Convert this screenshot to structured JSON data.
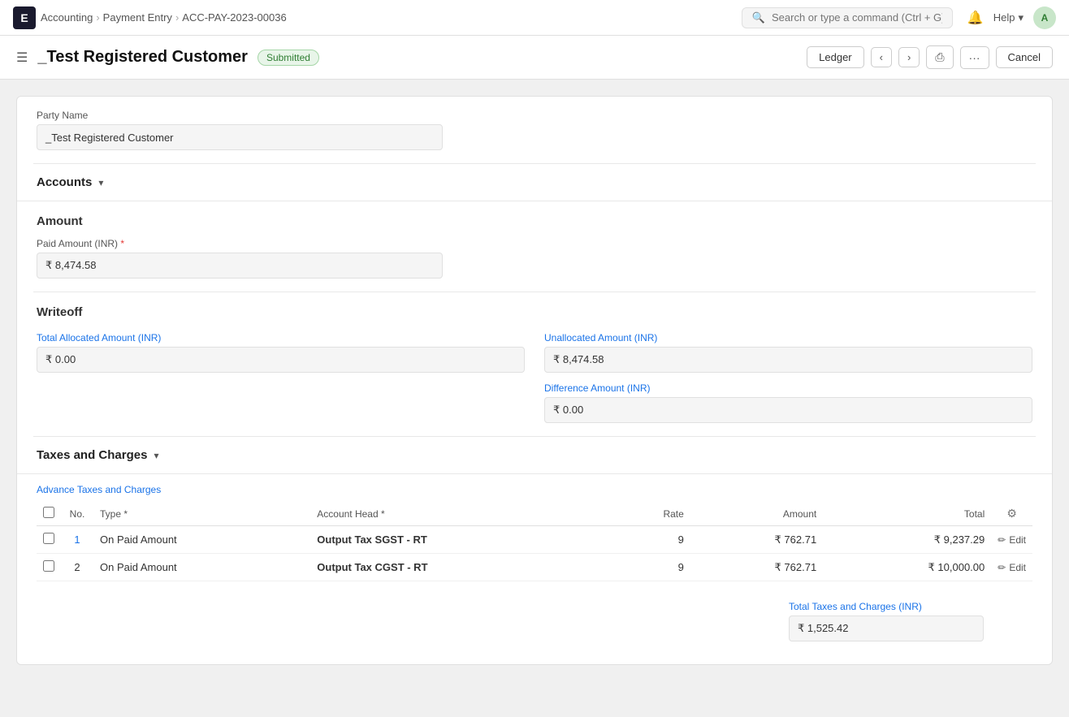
{
  "topbar": {
    "logo_letter": "E",
    "breadcrumb": [
      {
        "label": "Accounting",
        "href": "#"
      },
      {
        "label": "Payment Entry",
        "href": "#"
      },
      {
        "label": "ACC-PAY-2023-00036",
        "href": "#"
      }
    ],
    "search_placeholder": "Search or type a command (Ctrl + G)",
    "help_label": "Help",
    "avatar_letter": "A"
  },
  "page": {
    "hamburger_icon": "☰",
    "title": "_Test Registered Customer",
    "status": "Submitted",
    "actions": {
      "ledger": "Ledger",
      "prev": "‹",
      "next": "›",
      "print": "⎙",
      "more": "···",
      "cancel": "Cancel"
    }
  },
  "party_name": {
    "label": "Party Name",
    "value": "_Test Registered Customer"
  },
  "accounts_section": {
    "title": "Accounts",
    "chevron": "▾"
  },
  "amount_section": {
    "title": "Amount",
    "paid_amount_label": "Paid Amount (INR)",
    "paid_amount_required": "*",
    "paid_amount_value": "₹ 8,474.58"
  },
  "writeoff_section": {
    "title": "Writeoff",
    "total_allocated_label": "Total Allocated Amount (INR)",
    "total_allocated_value": "₹ 0.00",
    "unallocated_label": "Unallocated Amount (INR)",
    "unallocated_value": "₹ 8,474.58",
    "difference_label": "Difference Amount (INR)",
    "difference_value": "₹ 0.00"
  },
  "taxes_section": {
    "title": "Taxes and Charges",
    "chevron": "▾",
    "advance_taxes_label": "Advance Taxes and Charges",
    "columns": [
      {
        "key": "checkbox",
        "label": ""
      },
      {
        "key": "no",
        "label": "No."
      },
      {
        "key": "type",
        "label": "Type"
      },
      {
        "key": "account_head",
        "label": "Account Head"
      },
      {
        "key": "rate",
        "label": "Rate"
      },
      {
        "key": "amount",
        "label": "Amount"
      },
      {
        "key": "total",
        "label": "Total"
      },
      {
        "key": "gear",
        "label": ""
      }
    ],
    "rows": [
      {
        "no": "1",
        "type": "On Paid Amount",
        "account_head": "Output Tax SGST - RT",
        "rate": "9",
        "amount": "₹ 762.71",
        "total": "₹ 9,237.29",
        "edit_label": "Edit"
      },
      {
        "no": "2",
        "type": "On Paid Amount",
        "account_head": "Output Tax CGST - RT",
        "rate": "9",
        "amount": "₹ 762.71",
        "total": "₹ 10,000.00",
        "edit_label": "Edit"
      }
    ],
    "total_taxes_label": "Total Taxes and Charges (INR)",
    "total_taxes_value": "₹ 1,525.42"
  }
}
